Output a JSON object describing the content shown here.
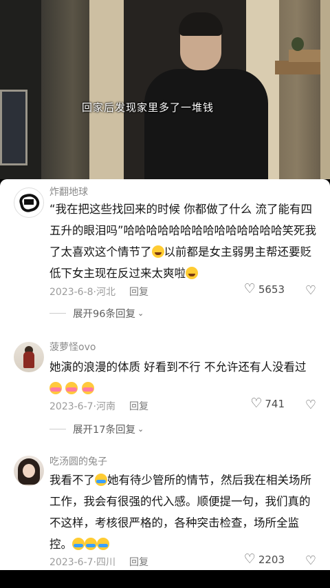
{
  "video": {
    "subtitle": "回家后发现家里多了一堆钱"
  },
  "comments": [
    {
      "username": "炸翻地球",
      "text_parts": [
        "“我在把这些找回来的时候 你都做了什么 流了能有四五升的眼泪吗”哈哈哈哈哈哈哈哈哈哈哈哈哈哈笑死我了太喜欢这个情节了",
        "以前都是女主弱男主帮还要贬低下女主现在反过来太爽啦"
      ],
      "date": "2023-6-8",
      "location": "河北",
      "reply_label": "回复",
      "likes": "5653",
      "expand_label": "展开96条回复"
    },
    {
      "username": "菠萝怪ovo",
      "text_parts": [
        "她演的浪漫的体质 好看到不行 不允许还有人没看过"
      ],
      "date": "2023-6-7",
      "location": "河南",
      "reply_label": "回复",
      "likes": "741",
      "expand_label": "展开17条回复"
    },
    {
      "username": "吃汤圆的兔子",
      "text_parts": [
        "我看不了",
        "她有待少管所的情节，然后我在相关场所工作，我会有很强的代入感。顺便提一句，我们真的不这样，考核很严格的，各种突击检查，场所全监控。"
      ],
      "date": "2023-6-7",
      "location": "四川",
      "reply_label": "回复",
      "likes": "2203"
    }
  ],
  "separator": "·",
  "icons": {
    "like": "heart-outline-icon",
    "dislike": "broken-heart-icon",
    "expand": "chevron-down-icon"
  }
}
